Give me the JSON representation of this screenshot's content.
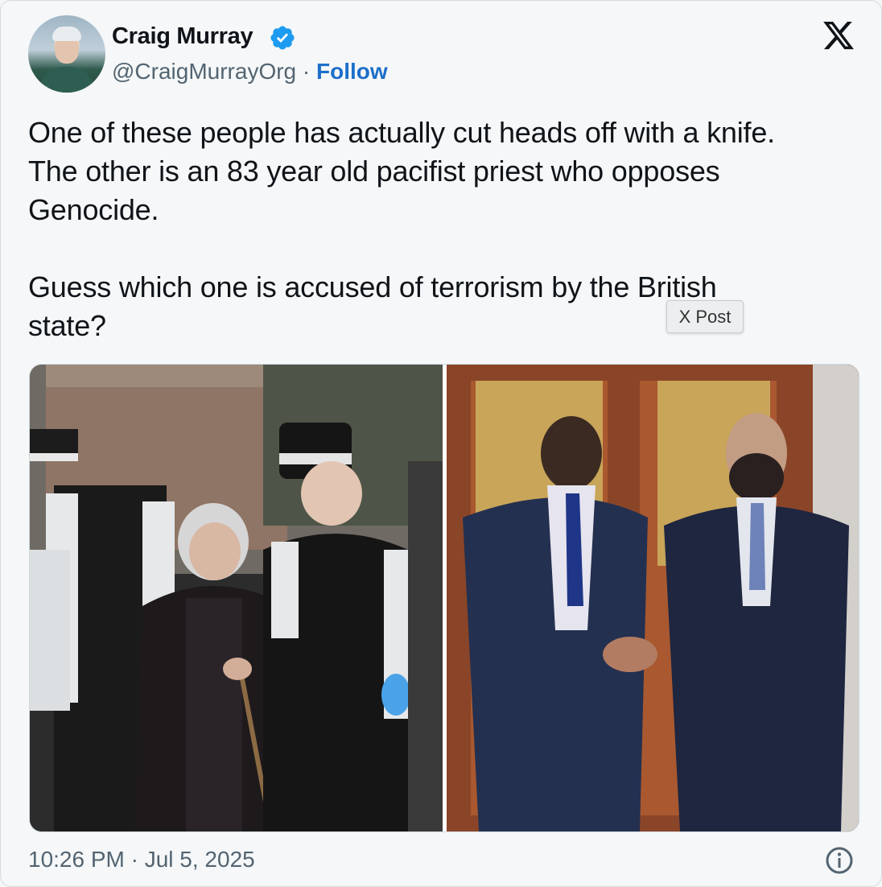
{
  "author": {
    "name": "Craig Murray",
    "handle": "@CraigMurrayOrg",
    "separator": "·",
    "follow_label": "Follow"
  },
  "tweet": {
    "text": "One of these people has actually cut heads off with a knife.\nThe other is an 83 year old pacifist priest who opposes\nGenocide.\n\nGuess which one is accused of terrorism by the British\nstate?"
  },
  "tooltip": {
    "label": "X Post"
  },
  "timestamp": "10:26 PM · Jul 5, 2025",
  "icons": {
    "verified": "verified-badge-icon",
    "logo": "x-logo-icon",
    "info": "info-icon"
  },
  "colors": {
    "verified": "#1d9bf0",
    "follow": "#1d6fc9",
    "muted": "#536471"
  }
}
